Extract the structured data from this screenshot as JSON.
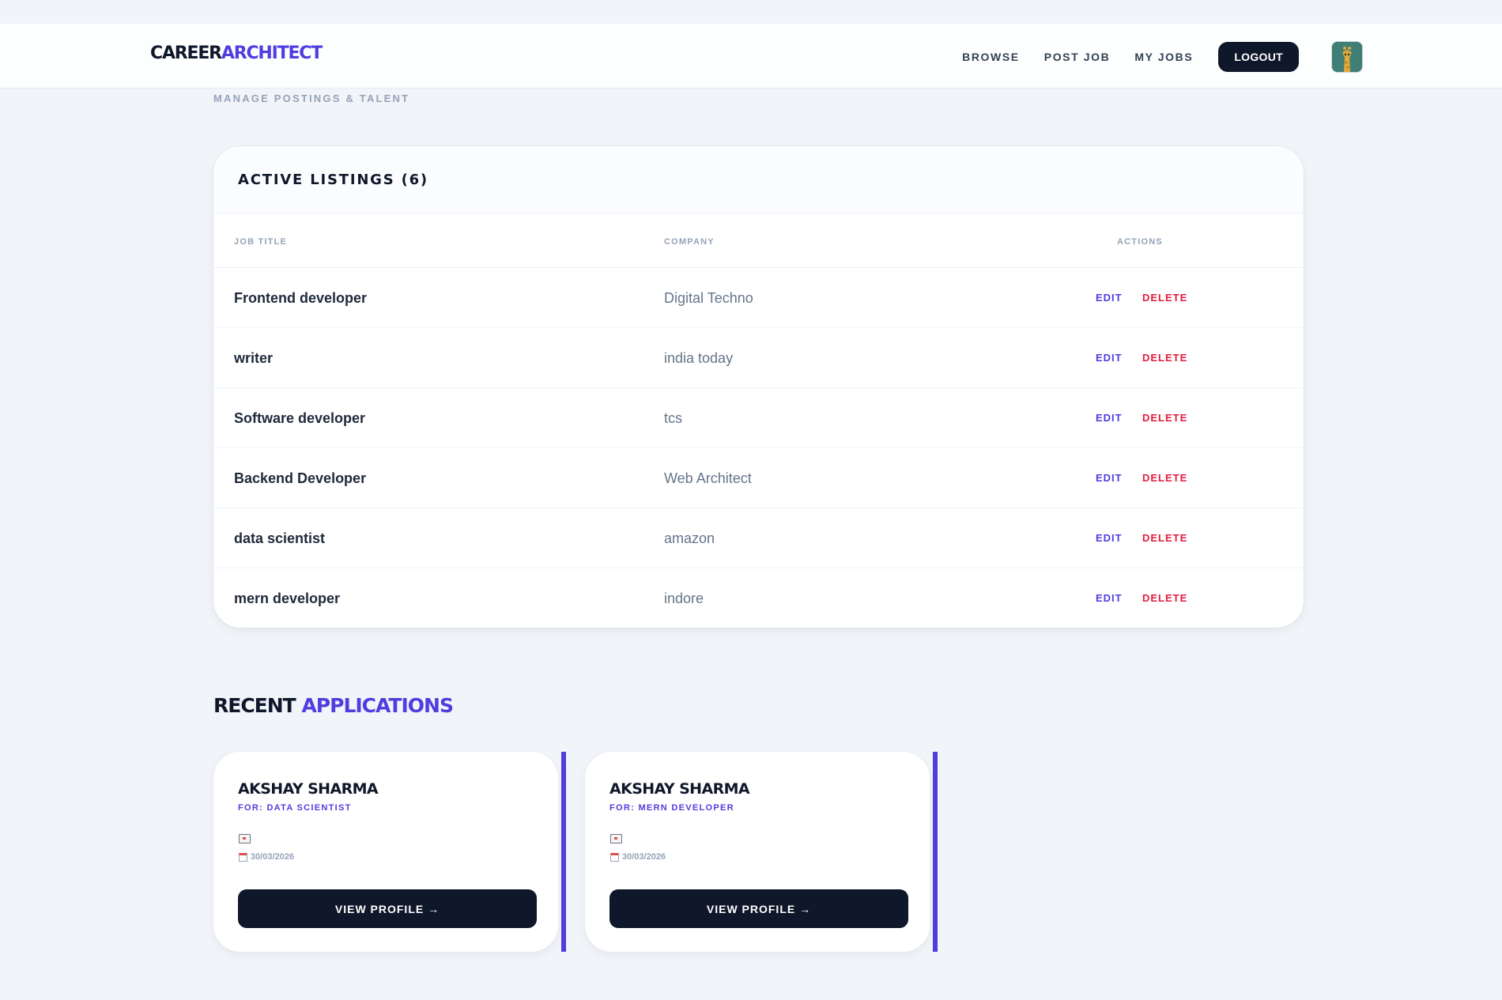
{
  "brand": {
    "part1": "CAREER",
    "part2": "ARCHITECT"
  },
  "nav": {
    "links": [
      "BROWSE",
      "POST JOB",
      "MY JOBS"
    ],
    "logout_label": "LOGOUT",
    "avatar_icon": "giraffe-avatar-icon"
  },
  "page": {
    "subtitle": "MANAGE POSTINGS & TALENT"
  },
  "listings": {
    "title": "ACTIVE LISTINGS (6)",
    "columns": {
      "job_title": "JOB TITLE",
      "company": "COMPANY",
      "actions": "ACTIONS"
    },
    "edit_label": "EDIT",
    "delete_label": "DELETE",
    "rows": [
      {
        "title": "Frontend developer",
        "company": "Digital Techno"
      },
      {
        "title": "writer",
        "company": "india today"
      },
      {
        "title": "Software developer",
        "company": "tcs"
      },
      {
        "title": "Backend Developer",
        "company": "Web Architect"
      },
      {
        "title": "data scientist",
        "company": "amazon"
      },
      {
        "title": "mern developer",
        "company": "indore"
      }
    ]
  },
  "applications": {
    "title_part1": "RECENT",
    "title_part2": "APPLICATIONS",
    "view_label": "VIEW PROFILE →",
    "items": [
      {
        "name": "AKSHAY SHARMA",
        "for": "FOR: DATA SCIENTIST",
        "date": "30/03/2026"
      },
      {
        "name": "AKSHAY SHARMA",
        "for": "FOR: MERN DEVELOPER",
        "date": "30/03/2026"
      }
    ]
  },
  "colors": {
    "accent": "#4f3de0",
    "danger": "#e11d3f",
    "dark": "#0f172a",
    "bg": "#f1f4f8"
  }
}
